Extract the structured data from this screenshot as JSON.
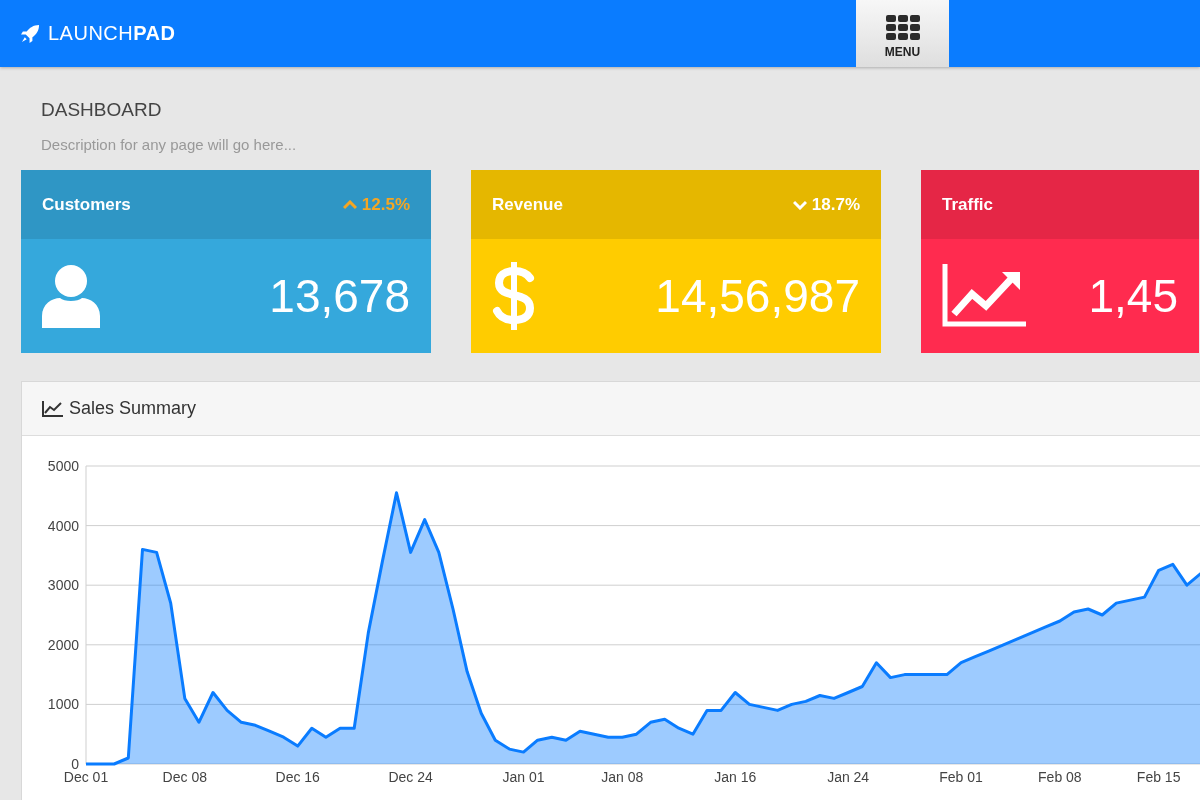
{
  "app": {
    "brand_light": "LAUNCH",
    "brand_bold": "PAD",
    "menu_label": "MENU"
  },
  "page": {
    "title": "DASHBOARD",
    "description": "Description for any page will go here..."
  },
  "cards": [
    {
      "kind": "user",
      "title": "Customers",
      "change": "12.5%",
      "rising": true,
      "value": "13,678",
      "color": "#35a8dc"
    },
    {
      "kind": "dollar",
      "title": "Revenue",
      "change": "18.7%",
      "rising": false,
      "value": "14,56,987",
      "color": "#ffcc00"
    },
    {
      "kind": "trend",
      "title": "Traffic",
      "value": "1,45",
      "color": "#ff2b4f"
    }
  ],
  "panel": {
    "title": "Sales Summary",
    "chart_data": {
      "type": "area",
      "categories": [
        "Dec 01",
        null,
        null,
        null,
        null,
        null,
        null,
        "Dec 08",
        null,
        null,
        null,
        null,
        null,
        null,
        null,
        "Dec 16",
        null,
        null,
        null,
        null,
        null,
        null,
        null,
        "Dec 24",
        null,
        null,
        null,
        null,
        null,
        null,
        null,
        "Jan 01",
        null,
        null,
        null,
        null,
        null,
        null,
        "Jan 08",
        null,
        null,
        null,
        null,
        null,
        null,
        null,
        "Jan 16",
        null,
        null,
        null,
        null,
        null,
        null,
        null,
        "Jan 24",
        null,
        null,
        null,
        null,
        null,
        null,
        null,
        "Feb 01",
        null,
        null,
        null,
        null,
        null,
        null,
        "Feb 08",
        null,
        null,
        null,
        null,
        null,
        null,
        "Feb 15",
        null,
        null,
        null
      ],
      "series": [
        {
          "color": "#0a7cff",
          "values": [
            0,
            0,
            0,
            100,
            3600,
            3550,
            2700,
            1100,
            700,
            1200,
            900,
            700,
            650,
            550,
            450,
            300,
            600,
            450,
            600,
            600,
            2200,
            3400,
            4550,
            3550,
            4100,
            3550,
            2600,
            1550,
            850,
            400,
            250,
            200,
            400,
            450,
            400,
            550,
            500,
            450,
            450,
            500,
            700,
            750,
            600,
            500,
            900,
            900,
            1200,
            1000,
            950,
            900,
            1000,
            1050,
            1150,
            1100,
            1200,
            1300,
            1700,
            1450,
            1500,
            1500,
            1500,
            1500,
            1700,
            1800,
            1900,
            2000,
            2100,
            2200,
            2300,
            2400,
            2550,
            2600,
            2500,
            2700,
            2750,
            2800,
            3250,
            3350,
            3000,
            3200
          ]
        }
      ],
      "grid": true,
      "ylim": [
        0,
        5000
      ],
      "yticks": [
        0,
        1000,
        2000,
        3000,
        4000,
        5000
      ]
    }
  }
}
